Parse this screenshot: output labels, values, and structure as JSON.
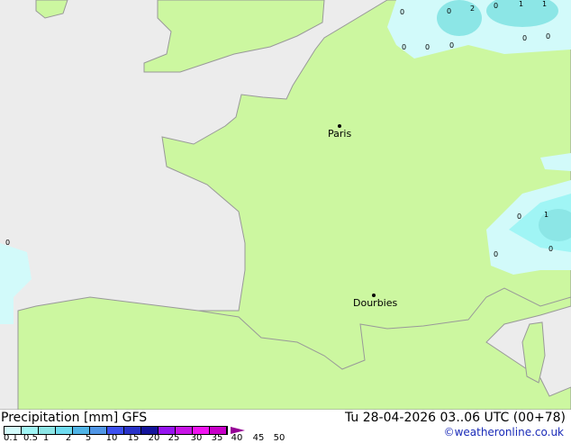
{
  "cities": [
    {
      "name": "Paris"
    },
    {
      "name": "Dourbies"
    }
  ],
  "values": [
    "0",
    "2",
    "0",
    "1",
    "1",
    "0",
    "0",
    "0",
    "0",
    "0",
    "0",
    "1",
    "0",
    "0",
    "0",
    "0"
  ],
  "footer": {
    "title": "Precipitation [mm]  GFS",
    "datetime": "Tu 28-04-2026 03..06 UTC (00+78)",
    "copyright": "©weatheronline.co.uk",
    "ticks": [
      "0.1",
      "0.5",
      "1",
      "2",
      "5",
      "10",
      "15",
      "20",
      "25",
      "30",
      "35",
      "40",
      "45",
      "50"
    ],
    "colors": [
      "#d2fafa",
      "#a0f5f5",
      "#8ce6e6",
      "#6edcf0",
      "#50b4e6",
      "#5096e6",
      "#3c50f0",
      "#2832c8",
      "#14149b",
      "#9614f0",
      "#c814e6",
      "#f014f0",
      "#c800c8",
      "#960096"
    ]
  }
}
